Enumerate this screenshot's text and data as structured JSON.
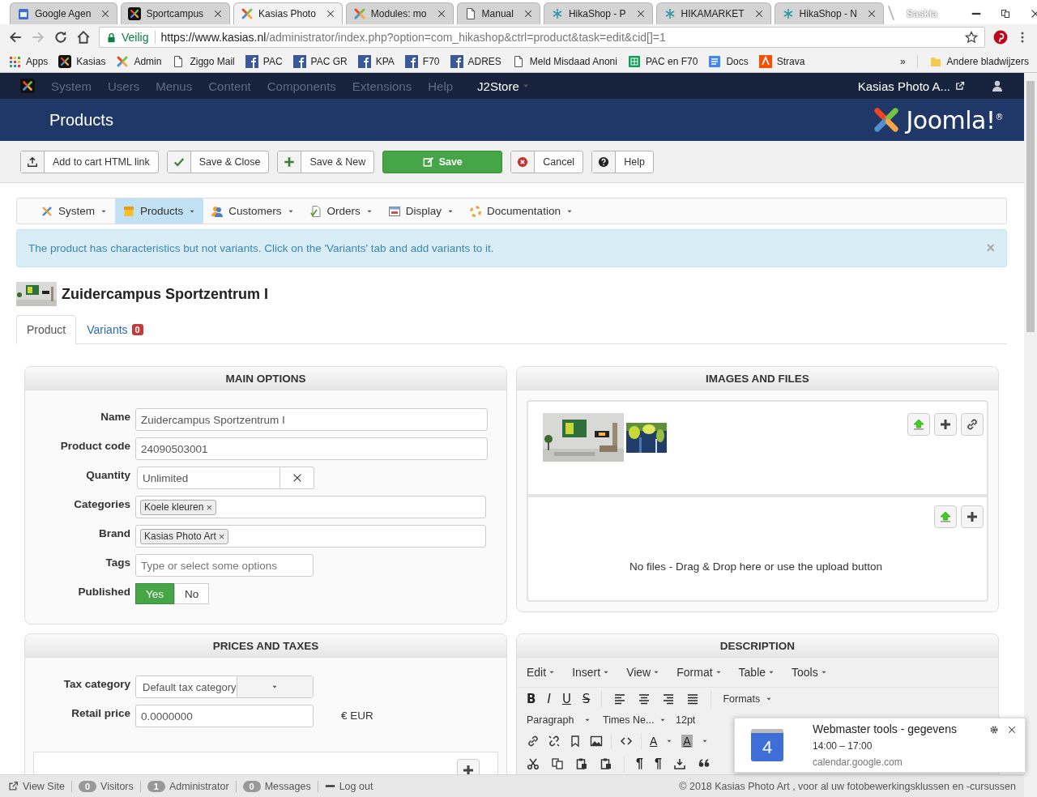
{
  "browser": {
    "tabs": [
      {
        "title": "Google Agen",
        "selected": false
      },
      {
        "title": "Sportcampus",
        "selected": false
      },
      {
        "title": "Kasias Photo",
        "selected": true
      },
      {
        "title": "Modules: mo",
        "selected": false
      },
      {
        "title": "Manual",
        "selected": false
      },
      {
        "title": "HikaShop - P",
        "selected": false
      },
      {
        "title": "HIKAMARKET",
        "selected": false
      },
      {
        "title": "HikaShop - N",
        "selected": false
      }
    ],
    "profile": "Saskia",
    "secure_label": "Veilig",
    "url_host": "https://www.kasias.nl",
    "url_path": "/administrator/index.php?option=com_hikashop&ctrl=product&task=edit&cid[]=1",
    "bookmarks": [
      "Apps",
      "Kasias",
      "Admin",
      "Ziggo Mail",
      "PAC",
      "PAC GR",
      "KPA",
      "F70",
      "ADRES",
      "Meld Misdaad Anoni",
      "PAC en F70",
      "Docs",
      "Strava"
    ],
    "more": "»",
    "other_bookmarks": "Andere bladwijzers"
  },
  "admin": {
    "menu": [
      "System",
      "Users",
      "Menus",
      "Content",
      "Components",
      "Extensions",
      "Help"
    ],
    "j2store": "J2Store",
    "site": "Kasias Photo A...",
    "page_title": "Products",
    "logo": "Joomla!$^{®}$"
  },
  "toolbar": [
    {
      "label": "Add to cart HTML link",
      "primary": false
    },
    {
      "label": "Save & Close",
      "primary": false
    },
    {
      "label": "Save & New",
      "primary": false
    },
    {
      "label": "Save",
      "primary": true
    },
    {
      "label": "Cancel",
      "primary": false
    },
    {
      "label": "Help",
      "primary": false
    }
  ],
  "submenu": [
    {
      "label": "System",
      "selected": false
    },
    {
      "label": "Products",
      "selected": true
    },
    {
      "label": "Customers",
      "selected": false
    },
    {
      "label": "Orders",
      "selected": false
    },
    {
      "label": "Display",
      "selected": false
    },
    {
      "label": "Documentation",
      "selected": false
    }
  ],
  "alert": {
    "text": "The product has characteristics but not variants. Click on the 'Variants' tab and add variants to it.",
    "close": "×"
  },
  "product": {
    "title": "Zuidercampus Sportzentrum I",
    "tabs": [
      {
        "label": "Product",
        "selected": true
      },
      {
        "label": "Variants",
        "badge": "0",
        "selected": false
      }
    ]
  },
  "main_options": {
    "title": "MAIN OPTIONS",
    "fields": [
      {
        "kind": "text",
        "label": "Name",
        "value": "Zuidercampus Sportzentrum I"
      },
      {
        "kind": "text",
        "label": "Product code",
        "value": "24090503001"
      },
      {
        "kind": "clearable",
        "label": "Quantity",
        "value": "Unlimited"
      },
      {
        "kind": "tags",
        "label": "Categories",
        "tags": [
          {
            "label": "Koele kleuren",
            "remove": "×"
          }
        ]
      },
      {
        "kind": "tags",
        "label": "Brand",
        "tags": [
          {
            "label": "Kasias Photo Art",
            "remove": "×"
          }
        ]
      },
      {
        "kind": "empty",
        "label": "Tags",
        "placeholder": "Type or select some options"
      },
      {
        "kind": "toggle",
        "label": "Published",
        "options": [
          {
            "label": "Yes",
            "selected": true
          },
          {
            "label": "No",
            "selected": false
          }
        ]
      }
    ]
  },
  "images": {
    "title": "IMAGES AND FILES",
    "no_files": "No files - Drag & Drop here or use the upload button"
  },
  "prices": {
    "title": "PRICES AND TAXES",
    "tax_label": "Tax category",
    "tax_value": "Default tax category",
    "price_label": "Retail price",
    "price_value": "0.0000000",
    "currency": "€ EUR"
  },
  "description": {
    "title": "DESCRIPTION",
    "menu": [
      "Edit",
      "Insert",
      "View",
      "Format",
      "Table",
      "Tools"
    ],
    "format_buttons": [
      {
        "label": "B",
        "kind": "bold"
      },
      {
        "label": "I",
        "kind": "italic"
      },
      {
        "label": "U",
        "kind": "underline"
      },
      {
        "label": "S",
        "kind": "strike"
      }
    ],
    "formats": "Formats",
    "paragraph": "Paragraph",
    "font": "Times Ne...",
    "size": "12pt",
    "text_color": "A",
    "background_color": "A",
    "pilcrows": [
      "¶",
      "¶"
    ]
  },
  "notification": {
    "day": "4",
    "title": "Webmaster tools - gegevens",
    "time": "14:00 – 17:00",
    "source": "calendar.google.com"
  },
  "status": {
    "view_site": "View Site",
    "counters": [
      {
        "count": "0",
        "label": "Visitors"
      },
      {
        "count": "1",
        "label": "Administrator"
      },
      {
        "count": "0",
        "label": "Messages"
      }
    ],
    "logout": "Log out",
    "copyright": "© 2018 Kasias Photo Art , voor al uw fotobewerkingsklussen en -cursussen"
  }
}
